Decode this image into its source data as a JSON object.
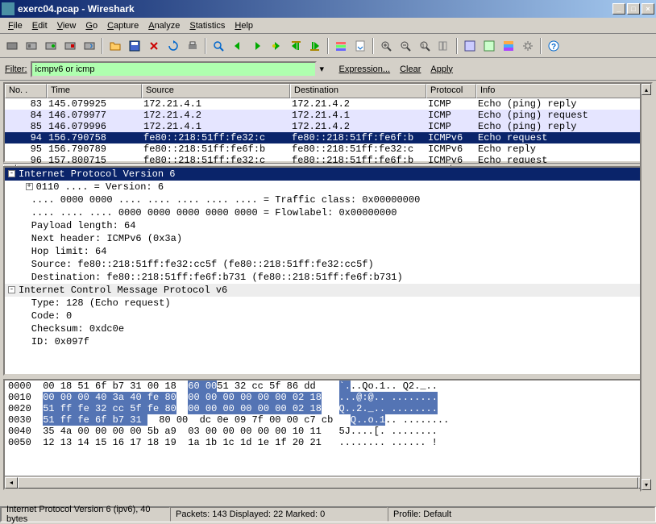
{
  "window": {
    "title": "exerc04.pcap  -  Wireshark"
  },
  "menu": [
    "File",
    "Edit",
    "View",
    "Go",
    "Capture",
    "Analyze",
    "Statistics",
    "Help"
  ],
  "filter": {
    "label": "Filter:",
    "value": "icmpv6 or icmp",
    "expression": "Expression...",
    "clear": "Clear",
    "apply": "Apply"
  },
  "columns": {
    "no": "No. .",
    "time": "Time",
    "source": "Source",
    "destination": "Destination",
    "protocol": "Protocol",
    "info": "Info"
  },
  "packets": [
    {
      "no": "83",
      "time": "145.079925",
      "src": "172.21.4.1",
      "dst": "172.21.4.2",
      "proto": "ICMP",
      "info": "Echo (ping) reply",
      "alt": false,
      "sel": false
    },
    {
      "no": "84",
      "time": "146.079977",
      "src": "172.21.4.2",
      "dst": "172.21.4.1",
      "proto": "ICMP",
      "info": "Echo (ping) request",
      "alt": true,
      "sel": false
    },
    {
      "no": "85",
      "time": "146.079996",
      "src": "172.21.4.1",
      "dst": "172.21.4.2",
      "proto": "ICMP",
      "info": "Echo (ping) reply",
      "alt": true,
      "sel": false
    },
    {
      "no": "94",
      "time": "156.790758",
      "src": "fe80::218:51ff:fe32:c",
      "dst": "fe80::218:51ff:fe6f:b",
      "proto": "ICMPv6",
      "info": "Echo request",
      "alt": false,
      "sel": true
    },
    {
      "no": "95",
      "time": "156.790789",
      "src": "fe80::218:51ff:fe6f:b",
      "dst": "fe80::218:51ff:fe32:c",
      "proto": "ICMPv6",
      "info": "Echo reply",
      "alt": false,
      "sel": false
    },
    {
      "no": "96",
      "time": "157.800715",
      "src": "fe80::218:51ff:fe32:c",
      "dst": "fe80::218:51ff:fe6f:b",
      "proto": "ICMPv6",
      "info": "Echo request",
      "alt": false,
      "sel": false
    }
  ],
  "detail": {
    "header": "Internet Protocol Version 6",
    "lines": [
      "    0110 .... = Version: 6",
      "    .... 0000 0000 .... .... .... .... .... = Traffic class: 0x00000000",
      "    .... .... .... 0000 0000 0000 0000 0000 = Flowlabel: 0x00000000",
      "    Payload length: 64",
      "    Next header: ICMPv6 (0x3a)",
      "    Hop limit: 64",
      "    Source: fe80::218:51ff:fe32:cc5f (fe80::218:51ff:fe32:cc5f)",
      "    Destination: fe80::218:51ff:fe6f:b731 (fe80::218:51ff:fe6f:b731)"
    ],
    "section2": "Internet Control Message Protocol v6",
    "lines2": [
      "    Type: 128 (Echo request)",
      "    Code: 0",
      "    Checksum: 0xdc0e",
      "    ID: 0x097f"
    ]
  },
  "hex": [
    {
      "off": "0000",
      "b1": "00 18 51 6f b7 31 00 18",
      "b2": "51 32 cc 5f 86 dd ",
      "b2s": "60 00",
      "a1": "..Qo.1.. Q2._..",
      "a1s": "`."
    },
    {
      "off": "0010",
      "b1s": "00 00 00 40 3a 40 fe 80",
      "b2s": "00 00 00 00 00 00 02 18",
      "a1s": "...@:@.. ........"
    },
    {
      "off": "0020",
      "b1s": "51 ff fe 32 cc 5f fe 80",
      "b2s": "00 00 00 00 00 00 02 18",
      "a1s": "Q..2._.. ........"
    },
    {
      "off": "0030",
      "b1s": "51 ff fe 6f b7 31 ",
      "b2": "80 00",
      "b3": "dc 0e 09 7f 00 00 c7 cb",
      "a1s": "Q..o.1",
      "a2": ".. ........"
    },
    {
      "off": "0040",
      "b1": "35 4a 00 00 00 00 5b a9",
      "b2": "03 00 00 00 00 00 10 11",
      "a1": "5J....[. ........"
    },
    {
      "off": "0050",
      "b1": "12 13 14 15 16 17 18 19",
      "b2": "1a 1b 1c 1d 1e 1f 20 21",
      "a1": "........ ...... !"
    }
  ],
  "status": {
    "s1": "Internet Protocol Version 6 (ipv6), 40 bytes",
    "s2": "Packets: 143 Displayed: 22 Marked: 0",
    "s3": "Profile: Default"
  }
}
